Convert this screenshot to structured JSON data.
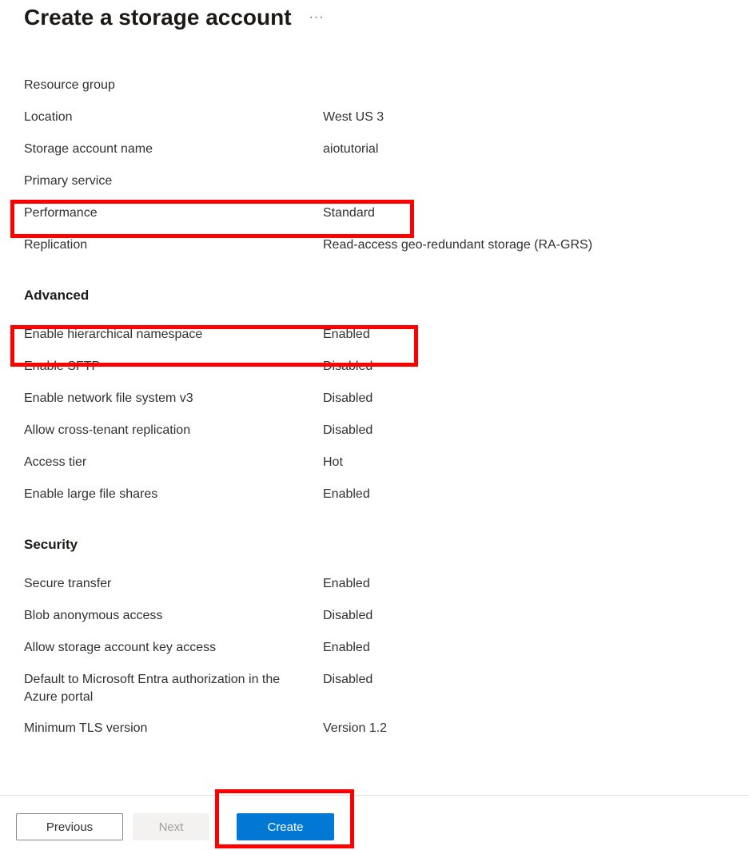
{
  "header": {
    "title": "Create a storage account"
  },
  "basics": {
    "rows": [
      {
        "label": "Resource group",
        "value": ""
      },
      {
        "label": "Location",
        "value": "West US 3"
      },
      {
        "label": "Storage account name",
        "value": "aiotutorial"
      },
      {
        "label": "Primary service",
        "value": ""
      },
      {
        "label": "Performance",
        "value": "Standard"
      },
      {
        "label": "Replication",
        "value": "Read-access geo-redundant storage (RA-GRS)"
      }
    ]
  },
  "advanced": {
    "title": "Advanced",
    "rows": [
      {
        "label": "Enable hierarchical namespace",
        "value": "Enabled"
      },
      {
        "label": "Enable SFTP",
        "value": "Disabled"
      },
      {
        "label": "Enable network file system v3",
        "value": "Disabled"
      },
      {
        "label": "Allow cross-tenant replication",
        "value": "Disabled"
      },
      {
        "label": "Access tier",
        "value": "Hot"
      },
      {
        "label": "Enable large file shares",
        "value": "Enabled"
      }
    ]
  },
  "security": {
    "title": "Security",
    "rows": [
      {
        "label": "Secure transfer",
        "value": "Enabled"
      },
      {
        "label": "Blob anonymous access",
        "value": "Disabled"
      },
      {
        "label": "Allow storage account key access",
        "value": "Enabled"
      },
      {
        "label": "Default to Microsoft Entra authorization in the Azure portal",
        "value": "Disabled"
      },
      {
        "label": "Minimum TLS version",
        "value": "Version 1.2"
      }
    ]
  },
  "footer": {
    "previous": "Previous",
    "next": "Next",
    "create": "Create"
  }
}
